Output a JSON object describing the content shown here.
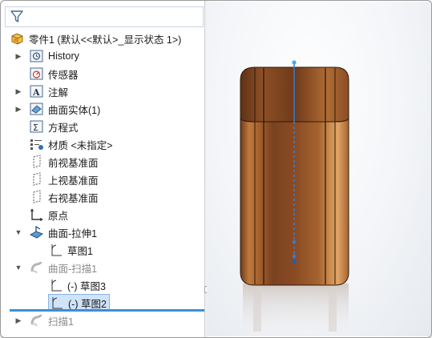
{
  "tree": {
    "root": {
      "label": "零件1  (默认<<默认>_显示状态 1>)"
    },
    "items": [
      {
        "label": "History",
        "icon": "history-icon",
        "expander": "▶",
        "dim": false
      },
      {
        "label": "传感器",
        "icon": "sensor-icon",
        "expander": "",
        "dim": false
      },
      {
        "label": "注解",
        "icon": "annotation-icon",
        "expander": "▶",
        "dim": false
      },
      {
        "label": "曲面实体(1)",
        "icon": "surface-bodies-icon",
        "expander": "▶",
        "dim": false
      },
      {
        "label": "方程式",
        "icon": "equations-icon",
        "expander": "",
        "dim": false
      },
      {
        "label": "材质 <未指定>",
        "icon": "material-icon",
        "expander": "",
        "dim": false
      },
      {
        "label": "前视基准面",
        "icon": "front-plane-icon",
        "expander": "",
        "dim": false
      },
      {
        "label": "上视基准面",
        "icon": "top-plane-icon",
        "expander": "",
        "dim": false
      },
      {
        "label": "右视基准面",
        "icon": "right-plane-icon",
        "expander": "",
        "dim": false
      },
      {
        "label": "原点",
        "icon": "origin-icon",
        "expander": "",
        "dim": false
      },
      {
        "label": "曲面-拉伸1",
        "icon": "surface-extrude-icon",
        "expander": "▼",
        "dim": false
      },
      {
        "label": "草图1",
        "icon": "sketch-icon",
        "expander": "",
        "dim": false
      },
      {
        "label": "曲面-扫描1",
        "icon": "surface-sweep-icon",
        "expander": "▼",
        "dim": true
      },
      {
        "label": "(-) 草图3",
        "icon": "sketch-icon",
        "expander": "",
        "dim": false
      },
      {
        "label": "(-) 草图2",
        "icon": "sketch-icon",
        "expander": "",
        "dim": false,
        "selected": true
      },
      {
        "label": "扫描1",
        "icon": "sweep-icon",
        "expander": "▶",
        "dim": true
      }
    ]
  },
  "colors": {
    "selection": "#cfe3fb",
    "rollback_bar": "#3b8fd8",
    "surface_light": "#d08a4e",
    "surface_dark": "#6b3a1b",
    "path_line": "#2f7fd6"
  }
}
